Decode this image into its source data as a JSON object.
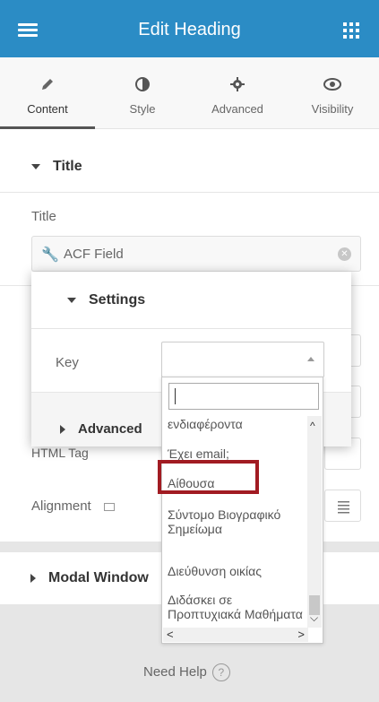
{
  "header": {
    "title": "Edit Heading",
    "menu_icon": "hamburger-icon",
    "apps_icon": "grid-icon"
  },
  "tabs": [
    {
      "label": "Content",
      "icon": "pencil-icon",
      "active": true
    },
    {
      "label": "Style",
      "icon": "contrast-icon",
      "active": false
    },
    {
      "label": "Advanced",
      "icon": "gear-icon",
      "active": false
    },
    {
      "label": "Visibility",
      "icon": "eye-icon",
      "active": false
    }
  ],
  "title_section": {
    "heading": "Title",
    "field_label": "Title",
    "field_value": "ACF Field"
  },
  "background_labels": {
    "html_tag": "HTML Tag",
    "alignment": "Alignment"
  },
  "popup": {
    "settings_heading": "Settings",
    "key_label": "Key",
    "key_value": "",
    "advanced_heading": "Advanced"
  },
  "dropdown": {
    "search_value": "",
    "options": [
      "ενδιαφέροντα",
      "Έχει email;",
      "Αίθουσα",
      "Σύντομο Βιογραφικό Σημείωμα",
      "Διεύθυνση οικίας",
      "Διδάσκει σε Προπτυχιακά Μαθήματα"
    ],
    "highlighted_option": "Αίθουσα"
  },
  "modal_section": {
    "heading": "Modal Window"
  },
  "footer": {
    "help_label": "Need Help"
  },
  "colors": {
    "header_bg": "#2b8cc5",
    "highlight_border": "#a11b22"
  }
}
